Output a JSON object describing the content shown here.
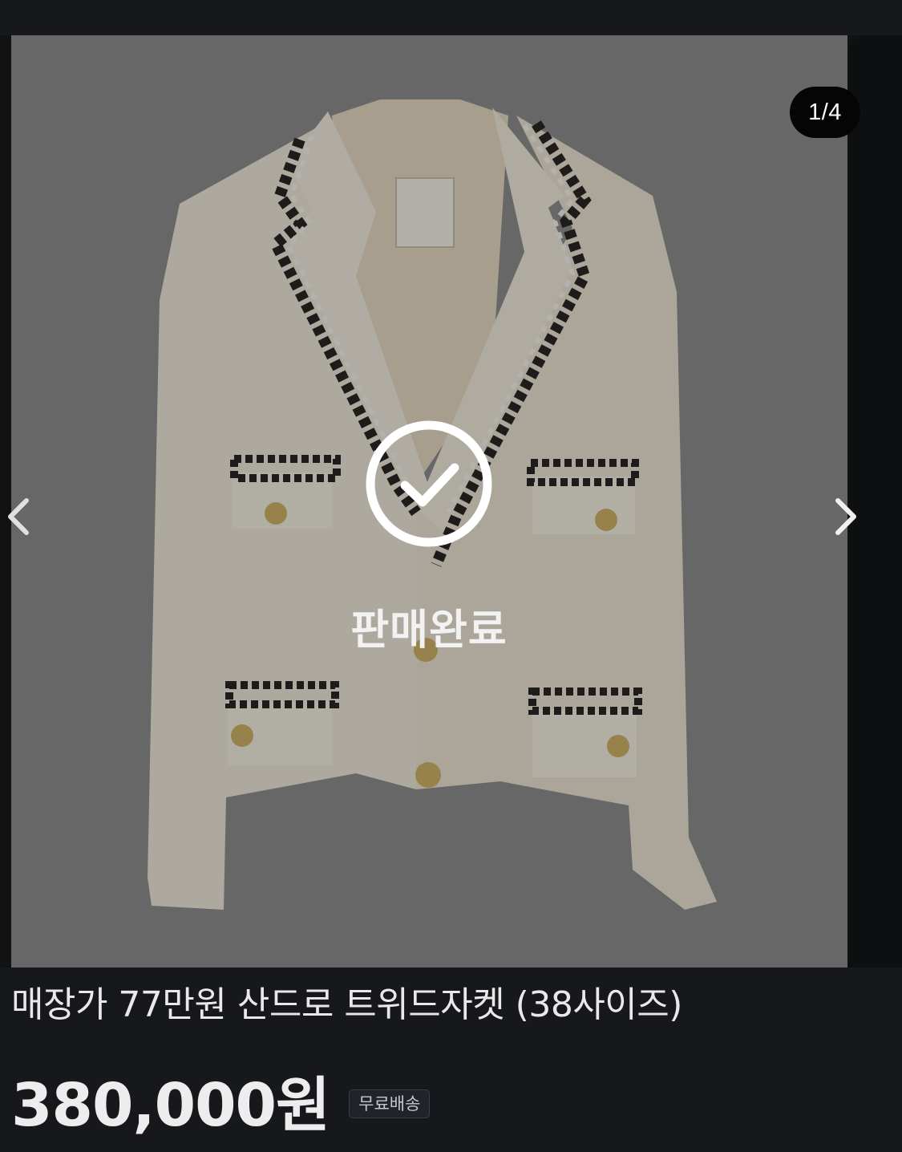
{
  "gallery": {
    "counter": "1/4",
    "current_index": 1,
    "total_images": 4,
    "sold_overlay_label": "판매완료",
    "icons": {
      "prev": "chevron-left-icon",
      "next": "chevron-right-icon",
      "sold": "check-circle-icon"
    }
  },
  "product": {
    "title": "매장가 77만원 산드로 트위드자켓 (38사이즈)",
    "price": "380,000원",
    "shipping_badge": "무료배송"
  },
  "colors": {
    "page_background": "#17181b",
    "photo_background": "#8f8f90",
    "jacket_cream": "#f1ebdb",
    "trim_dark": "#2a2626",
    "button_gold": "#d2b46a",
    "text_primary": "#e9e9ea",
    "counter_background": "#050505"
  }
}
